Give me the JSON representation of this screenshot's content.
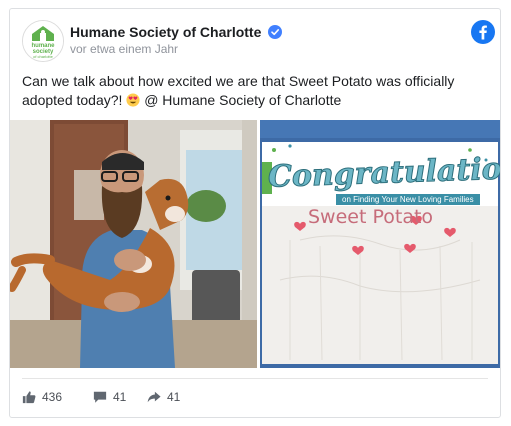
{
  "post": {
    "page_name": "Humane Society of Charlotte",
    "timestamp": "vor etwa einem Jahr",
    "text_before_emoji": "Can we talk about how excited we are that Sweet Potato was officially adopted today?! ",
    "text_after_emoji": " @ Humane Society of Charlotte",
    "avatar_logo_text": "humane society",
    "avatar_logo_subtext": "of charlotte",
    "photo_right": {
      "banner_text": "Congratulations",
      "banner_subtext": "on Finding Your New Loving Families",
      "dog_name": "Sweet Potato"
    }
  },
  "stats": {
    "likes": "436",
    "comments": "41",
    "shares": "41"
  },
  "icons": {
    "verified": "verified-badge-icon",
    "facebook": "facebook-logo-icon",
    "emoji": "heart-eyes-emoji-icon",
    "like": "thumbs-up-icon",
    "comment": "comment-bubble-icon",
    "share": "share-arrow-icon"
  },
  "colors": {
    "facebook_blue": "#1877f2",
    "verified_blue": "#4080ff",
    "brand_green": "#5fb14e"
  }
}
